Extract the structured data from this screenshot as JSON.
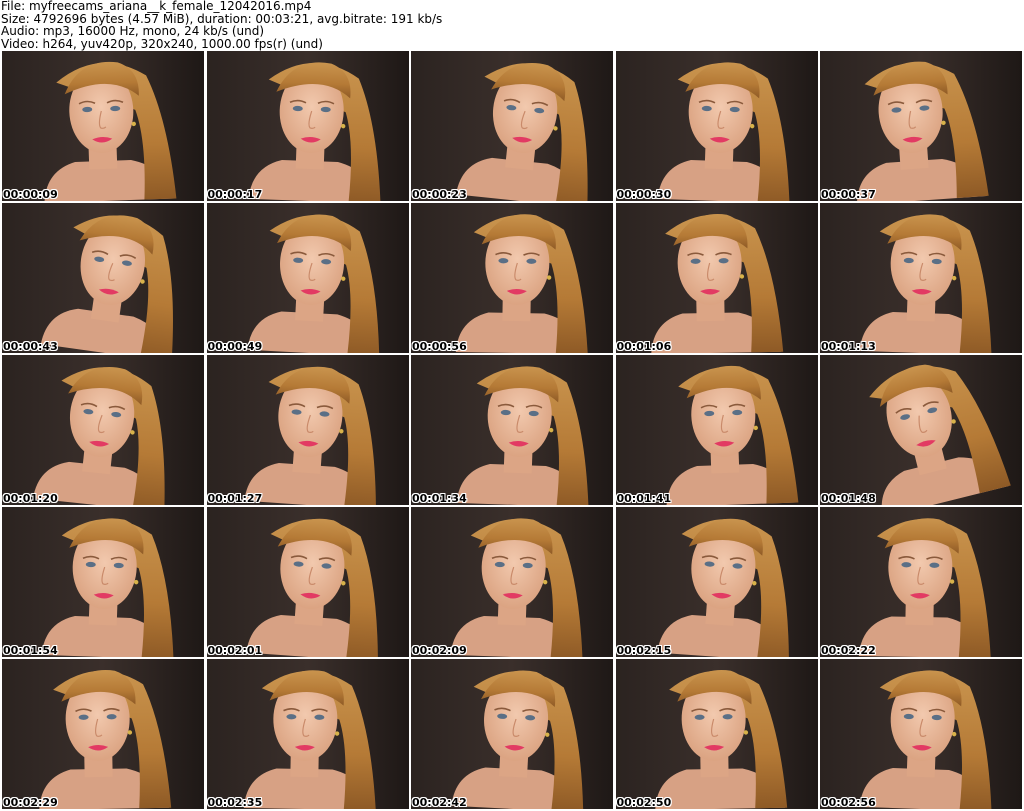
{
  "header": {
    "file_line": "File: myfreecams_ariana__k_female_12042016.mp4",
    "size_line": "Size: 4792696 bytes (4.57 MiB), duration: 00:03:21, avg.bitrate: 191 kb/s",
    "audio_line": "Audio: mp3, 16000 Hz, mono, 24 kb/s (und)",
    "video_line": "Video: h264, yuv420p, 320x240, 1000.00 fps(r) (und)"
  },
  "thumbnails": [
    {
      "timestamp": "00:00:09",
      "tilt": -2,
      "lean": 0
    },
    {
      "timestamp": "00:00:17",
      "tilt": 2,
      "lean": 4
    },
    {
      "timestamp": "00:00:23",
      "tilt": 6,
      "lean": 12
    },
    {
      "timestamp": "00:00:30",
      "tilt": 2,
      "lean": 4
    },
    {
      "timestamp": "00:00:37",
      "tilt": -4,
      "lean": -8
    },
    {
      "timestamp": "00:00:43",
      "tilt": 8,
      "lean": 8
    },
    {
      "timestamp": "00:00:49",
      "tilt": 3,
      "lean": 4
    },
    {
      "timestamp": "00:00:56",
      "tilt": 1,
      "lean": 6
    },
    {
      "timestamp": "00:01:06",
      "tilt": -1,
      "lean": -6
    },
    {
      "timestamp": "00:01:13",
      "tilt": 2,
      "lean": 2
    },
    {
      "timestamp": "00:01:20",
      "tilt": 6,
      "lean": -2
    },
    {
      "timestamp": "00:01:27",
      "tilt": 4,
      "lean": 2
    },
    {
      "timestamp": "00:01:34",
      "tilt": 2,
      "lean": 8
    },
    {
      "timestamp": "00:01:41",
      "tilt": -2,
      "lean": 8
    },
    {
      "timestamp": "00:01:48",
      "tilt": -14,
      "lean": 4
    },
    {
      "timestamp": "00:01:54",
      "tilt": 2,
      "lean": 2
    },
    {
      "timestamp": "00:02:01",
      "tilt": 4,
      "lean": 4
    },
    {
      "timestamp": "00:02:09",
      "tilt": 2,
      "lean": 2
    },
    {
      "timestamp": "00:02:15",
      "tilt": 4,
      "lean": 6
    },
    {
      "timestamp": "00:02:22",
      "tilt": 1,
      "lean": 0
    },
    {
      "timestamp": "00:02:29",
      "tilt": -1,
      "lean": -4
    },
    {
      "timestamp": "00:02:35",
      "tilt": 1,
      "lean": -2
    },
    {
      "timestamp": "00:02:42",
      "tilt": 3,
      "lean": 4
    },
    {
      "timestamp": "00:02:50",
      "tilt": -1,
      "lean": -2
    },
    {
      "timestamp": "00:02:56",
      "tilt": 2,
      "lean": 2
    }
  ]
}
